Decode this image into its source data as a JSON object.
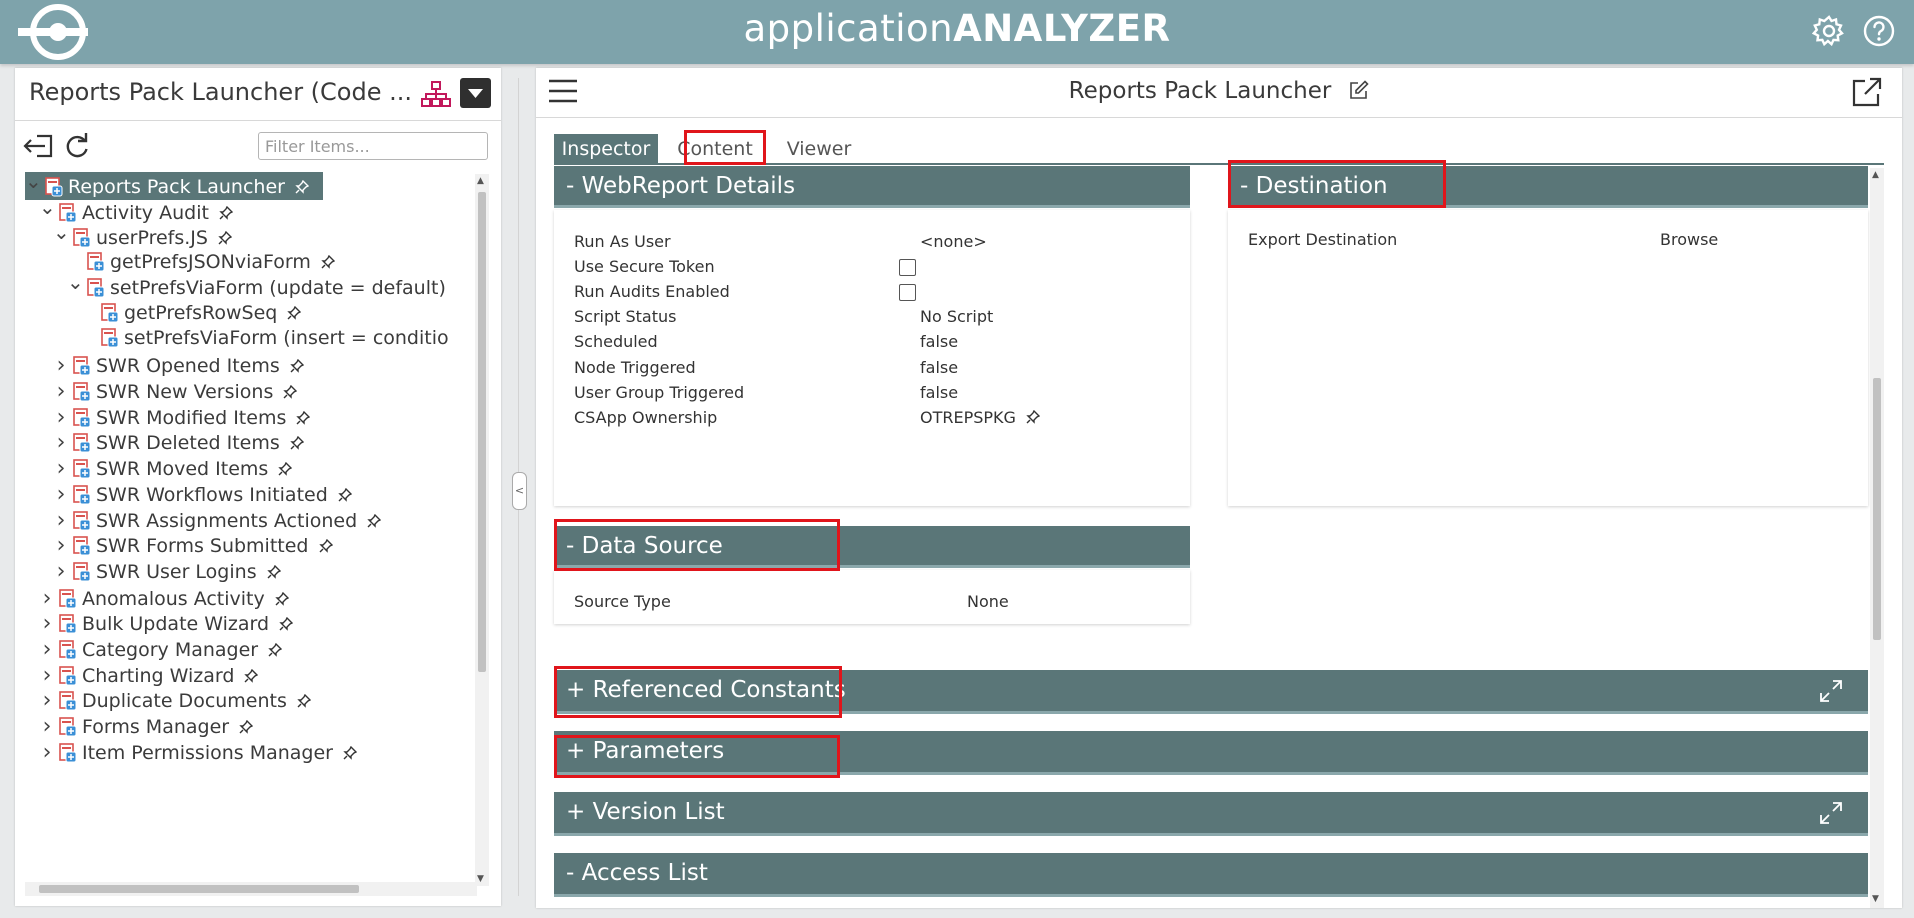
{
  "header": {
    "title_light": "application",
    "title_bold": "ANALYZER",
    "icons": [
      "logo-icon",
      "gear-icon",
      "help-icon"
    ]
  },
  "left_panel": {
    "title": "Reports Pack Launcher (Code ...",
    "filter_placeholder": "Filter Items...",
    "icons": [
      "tree-structure-icon",
      "chevron-down-icon",
      "back-icon",
      "refresh-icon"
    ],
    "tree": [
      {
        "label": "Reports Pack Launcher",
        "level": 0,
        "caret": "open",
        "selected": true,
        "pin": true
      },
      {
        "label": "Activity Audit",
        "level": 1,
        "caret": "open",
        "pin": true
      },
      {
        "label": "userPrefs.JS",
        "level": 2,
        "caret": "open",
        "pin": true
      },
      {
        "label": "getPrefsJSONviaForm",
        "level": 3,
        "caret": "none",
        "pin": true
      },
      {
        "label": "setPrefsViaForm (update = default)",
        "level": 3,
        "caret": "open",
        "pin": false
      },
      {
        "label": "getPrefsRowSeq",
        "level": 4,
        "caret": "none",
        "pin": true
      },
      {
        "label": "setPrefsViaForm (insert = conditio",
        "level": 4,
        "caret": "none",
        "pin": false
      },
      {
        "label": "SWR Opened Items",
        "level": 2,
        "caret": "closed",
        "pin": true
      },
      {
        "label": "SWR New Versions",
        "level": 2,
        "caret": "closed",
        "pin": true
      },
      {
        "label": "SWR Modified Items",
        "level": 2,
        "caret": "closed",
        "pin": true
      },
      {
        "label": "SWR Deleted Items",
        "level": 2,
        "caret": "closed",
        "pin": true
      },
      {
        "label": "SWR Moved Items",
        "level": 2,
        "caret": "closed",
        "pin": true
      },
      {
        "label": "SWR Workflows Initiated",
        "level": 2,
        "caret": "closed",
        "pin": true
      },
      {
        "label": "SWR Assignments Actioned",
        "level": 2,
        "caret": "closed",
        "pin": true
      },
      {
        "label": "SWR Forms Submitted",
        "level": 2,
        "caret": "closed",
        "pin": true
      },
      {
        "label": "SWR User Logins",
        "level": 2,
        "caret": "closed",
        "pin": true
      },
      {
        "label": "Anomalous Activity",
        "level": 1,
        "caret": "closed",
        "pin": true
      },
      {
        "label": "Bulk Update Wizard",
        "level": 1,
        "caret": "closed",
        "pin": true
      },
      {
        "label": "Category Manager",
        "level": 1,
        "caret": "closed",
        "pin": true
      },
      {
        "label": "Charting Wizard",
        "level": 1,
        "caret": "closed",
        "pin": true
      },
      {
        "label": "Duplicate Documents",
        "level": 1,
        "caret": "closed",
        "pin": true
      },
      {
        "label": "Forms Manager",
        "level": 1,
        "caret": "closed",
        "pin": true
      },
      {
        "label": "Item Permissions Manager",
        "level": 1,
        "caret": "closed",
        "pin": true
      }
    ]
  },
  "right_panel": {
    "title": "Reports Pack Launcher",
    "icons": [
      "menu-icon",
      "edit-icon",
      "open-external-icon",
      "expand-icon"
    ],
    "tabs": [
      {
        "label": "Inspector",
        "active": true
      },
      {
        "label": "Content",
        "active": false
      },
      {
        "label": "Viewer",
        "active": false
      }
    ],
    "webreport": {
      "header": "- WebReport Details",
      "rows": [
        {
          "label": "Run As User",
          "value": "<none>"
        },
        {
          "label": "Use Secure Token",
          "value": null,
          "checkbox": true
        },
        {
          "label": "Run Audits Enabled",
          "value": null,
          "checkbox": true
        },
        {
          "label": "Script Status",
          "value": "No Script"
        },
        {
          "label": "Scheduled",
          "value": "false"
        },
        {
          "label": "Node Triggered",
          "value": "false"
        },
        {
          "label": "User Group Triggered",
          "value": "false"
        },
        {
          "label": "CSApp Ownership",
          "value": "OTREPSPKG",
          "pin": true
        }
      ]
    },
    "destination": {
      "header": "- Destination",
      "rows": [
        {
          "label": "Export Destination",
          "value": "Browse"
        }
      ]
    },
    "data_source": {
      "header": "- Data Source",
      "rows": [
        {
          "label": "Source Type",
          "value": "None"
        }
      ]
    },
    "referenced_constants": {
      "header": "+ Referenced Constants"
    },
    "parameters": {
      "header": "+ Parameters"
    },
    "version_list": {
      "header": "+ Version List"
    },
    "access_list": {
      "header": "- Access List"
    }
  },
  "colors": {
    "header_bg": "#7ea3ab",
    "section_bg": "#5a7678",
    "highlight": "#e0151b"
  }
}
